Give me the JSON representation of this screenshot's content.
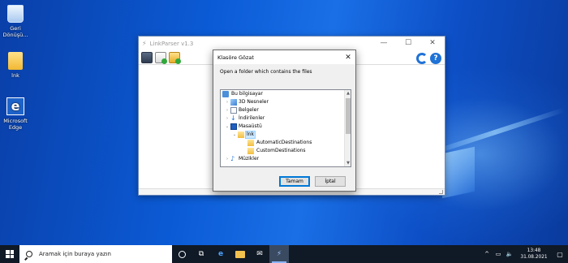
{
  "desktop": {
    "icons": [
      {
        "label": "Geri Dönüşü...",
        "icon": "recycle-bin-icon"
      },
      {
        "label": "lnk",
        "icon": "folder-icon"
      },
      {
        "label": "Microsoft Edge",
        "icon": "edge-icon"
      }
    ]
  },
  "linkparser": {
    "title": "LinkParser v1.3",
    "controls": {
      "minimize": "—",
      "maximize": "☐",
      "close": "✕"
    }
  },
  "dialog": {
    "title": "Klasöre Gözat",
    "close": "✕",
    "description": "Open a folder which contains the files",
    "tree": [
      {
        "label": "Bu bilgisayar",
        "icon": "computer-icon",
        "expander": "",
        "depth": 0
      },
      {
        "label": "3D Nesneler",
        "icon": "3d-objects-icon",
        "expander": "›",
        "depth": 1
      },
      {
        "label": "Belgeler",
        "icon": "documents-icon",
        "expander": "›",
        "depth": 1
      },
      {
        "label": "İndirilenler",
        "icon": "downloads-icon",
        "expander": "›",
        "depth": 1
      },
      {
        "label": "Masaüstü",
        "icon": "desktop-icon",
        "expander": "⌄",
        "depth": 1
      },
      {
        "label": "lnk",
        "icon": "folder-icon",
        "expander": "⌄",
        "depth": 2,
        "selected": true
      },
      {
        "label": "AutomaticDestinations",
        "icon": "folder-icon",
        "expander": "",
        "depth": 3
      },
      {
        "label": "CustomDestinations",
        "icon": "folder-icon",
        "expander": "",
        "depth": 3
      },
      {
        "label": "Müzikler",
        "icon": "music-icon",
        "expander": "›",
        "depth": 1
      }
    ],
    "ok_label": "Tamam",
    "cancel_label": "İptal"
  },
  "taskbar": {
    "search_placeholder": "Aramak için buraya yazın",
    "time": "13:48",
    "date": "31.08.2021",
    "tray_chevron": "^",
    "colors": {
      "bar": "#101926",
      "accent": "#0078d7"
    }
  }
}
